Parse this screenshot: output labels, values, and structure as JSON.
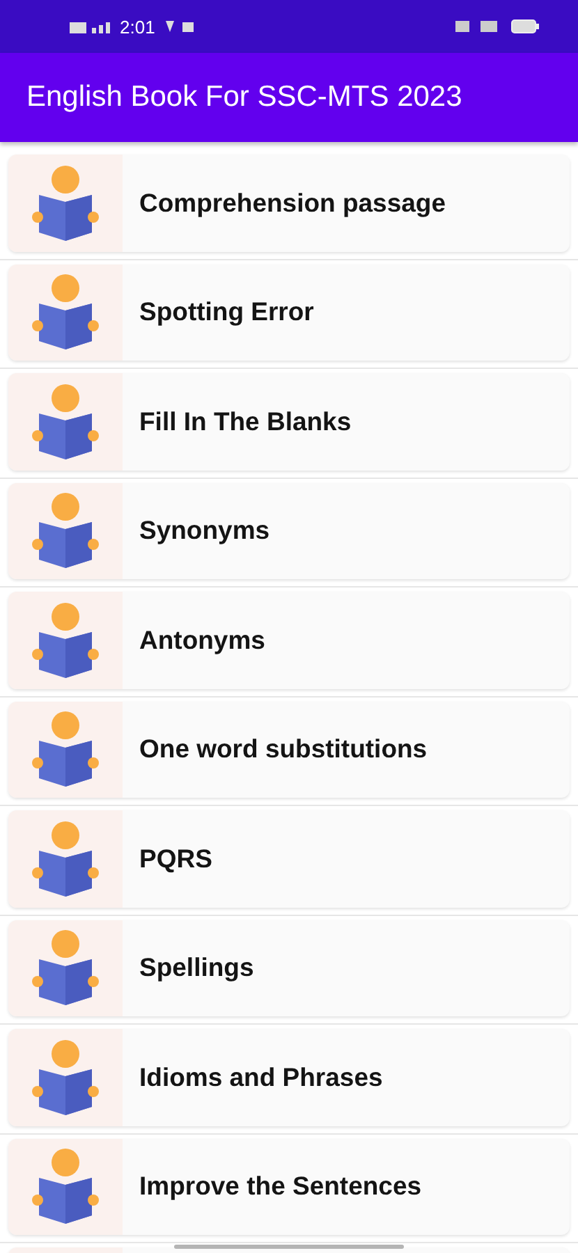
{
  "status_bar": {
    "time": "2:01"
  },
  "app_bar": {
    "title": "English Book For SSC-MTS 2023"
  },
  "chapters": [
    {
      "title": "Comprehension passage"
    },
    {
      "title": "Spotting Error"
    },
    {
      "title": "Fill In The Blanks"
    },
    {
      "title": "Synonyms"
    },
    {
      "title": "Antonyms"
    },
    {
      "title": "One word substitutions"
    },
    {
      "title": "PQRS"
    },
    {
      "title": "Spellings"
    },
    {
      "title": "Idioms and Phrases"
    },
    {
      "title": "Improve the Sentences"
    }
  ]
}
